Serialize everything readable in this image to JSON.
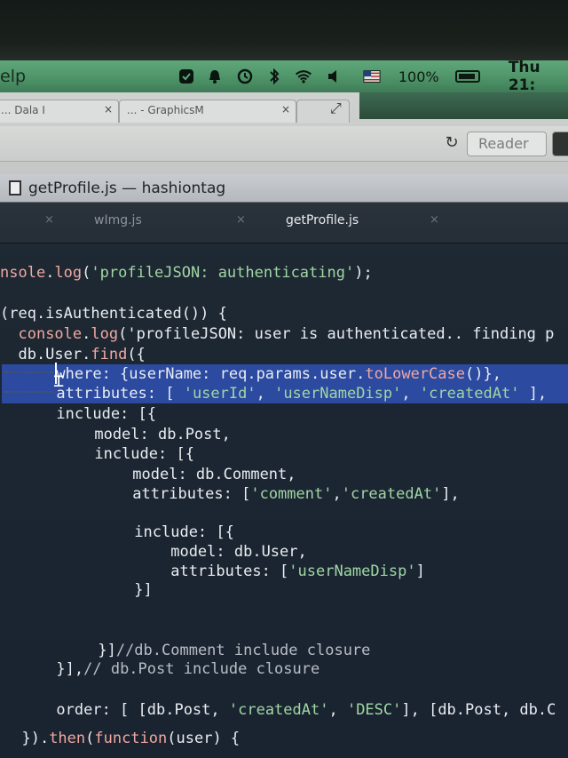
{
  "menubar": {
    "help_label": "elp",
    "battery_text": "100%",
    "clock": "Thu 21:",
    "icons": [
      "dropbox-icon",
      "bell-icon",
      "time-machine-icon",
      "bluetooth-icon",
      "wifi-icon",
      "volume-icon",
      "flag-icon",
      "battery-icon"
    ]
  },
  "browser": {
    "tabs": [
      {
        "label": "... Dala I"
      },
      {
        "label": "... - GraphicsM"
      },
      {
        "label": ""
      }
    ],
    "reader_label": "Reader"
  },
  "editor": {
    "window_title": "getProfile.js — hashiontag",
    "tabs": [
      {
        "label": "wImg.js",
        "active": false
      },
      {
        "label": "getProfile.js",
        "active": true
      }
    ],
    "code_lines": [
      "nsole.log('profileJSON: authenticating');",
      "(req.isAuthenticated()) {",
      "  console.log('profileJSON: user is authenticated.. finding p",
      "  db.User.find({",
      "      where: {userName: req.params.user.toLowerCase()},",
      "      attributes: [ 'userId', 'userNameDisp', 'createdAt' ],",
      "      include: [{",
      "          model: db.Post,",
      "          include: [{",
      "              model: db.Comment,",
      "              attributes: ['comment','createdAt'],",
      "              include: [{",
      "                  model: db.User,",
      "                  attributes: ['userNameDisp']",
      "              }]",
      "          }]//db.Comment include closure",
      "      }],// db.Post include closure",
      "      order: [ [db.Post, 'createdAt', 'DESC'], [db.Post, db.C",
      "  }).then(function(user) {"
    ]
  },
  "colors": {
    "menubar": "#4e9468",
    "editor_bg": "#1c2632",
    "selection": "#2b4aa0",
    "string": "#9fd7a4",
    "function": "#f0a8a0"
  }
}
